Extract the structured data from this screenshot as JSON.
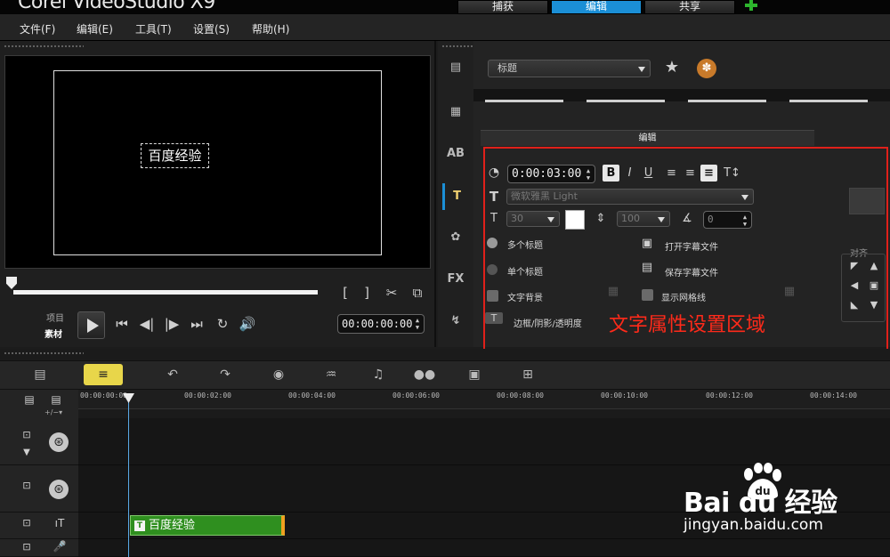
{
  "app": {
    "title": "Corel VideoStudio X9"
  },
  "steps": [
    {
      "label": "捕获"
    },
    {
      "label": "编辑"
    },
    {
      "label": "共享"
    }
  ],
  "menu": [
    {
      "label": "文件(F)"
    },
    {
      "label": "编辑(E)"
    },
    {
      "label": "工具(T)"
    },
    {
      "label": "设置(S)"
    },
    {
      "label": "帮助(H)"
    }
  ],
  "preview": {
    "caption": "百度经验",
    "mode_project": "项目",
    "mode_clip": "素材",
    "timecode": "00:00:00:00"
  },
  "library": {
    "icons": [
      "media-icon",
      "transition-icon",
      "title-icon",
      "text-icon",
      "graphic-icon",
      "fx-icon",
      "path-icon"
    ],
    "title_dropdown": "标题"
  },
  "options": {
    "tab_label": "编辑",
    "duration": "0:00:03:00",
    "font": "微软雅黑 Light",
    "font_size": "30",
    "line_spacing": "100",
    "angle": "0",
    "text_color": "#ffffff",
    "multi_title": "多个标题",
    "single_title": "单个标题",
    "text_background": "文字背景",
    "border_shadow": "边框/阴影/透明度",
    "open_subtitle": "打开字幕文件",
    "save_subtitle": "保存字幕文件",
    "show_grid": "显示网格线",
    "align_label": "对齐",
    "selected_mode": "multi"
  },
  "annotation": {
    "text": "文字属性设置区域",
    "color": "#ff2a1a"
  },
  "timeline": {
    "ruler": [
      "00:00:00:00",
      "00:00:02:00",
      "00:00:04:00",
      "00:00:06:00",
      "00:00:08:00",
      "00:00:10:00",
      "00:00:12:00",
      "00:00:14:00"
    ],
    "title_clip": "百度经验"
  },
  "watermark": {
    "brand": "Bai du 经验",
    "url": "jingyan.baidu.com"
  }
}
